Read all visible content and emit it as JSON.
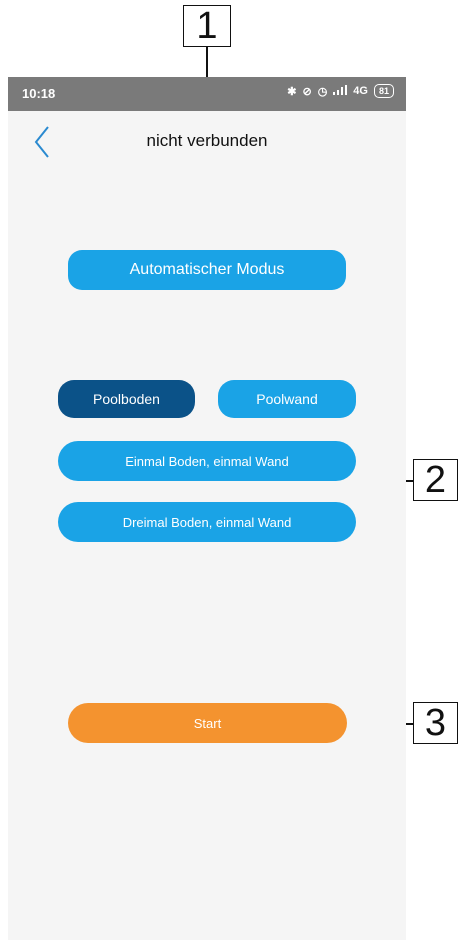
{
  "callouts": [
    "1",
    "2",
    "3"
  ],
  "status_bar": {
    "time": "10:18",
    "network": "4G",
    "battery": "81"
  },
  "header": {
    "title": "nicht verbunden"
  },
  "mode_button": "Automatischer Modus",
  "options": {
    "poolboden": "Poolboden",
    "poolwand": "Poolwand",
    "einmal": "Einmal Boden, einmal Wand",
    "dreimal": "Dreimal Boden, einmal Wand"
  },
  "start_button": "Start",
  "colors": {
    "primary": "#1aa3e6",
    "selected": "#0b5288",
    "start": "#f4932f",
    "status_bar": "#7a7a7a",
    "background": "#f5f5f5"
  }
}
